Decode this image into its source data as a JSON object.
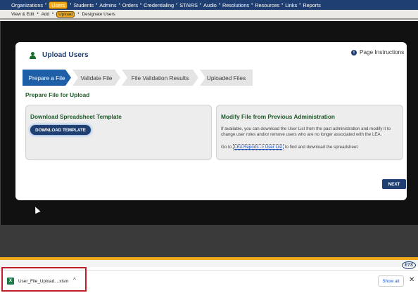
{
  "topnav": {
    "items": [
      {
        "label": "Organizations"
      },
      {
        "label": "Users",
        "active": true
      },
      {
        "label": "Students"
      },
      {
        "label": "Admins"
      },
      {
        "label": "Orders"
      },
      {
        "label": "Credentialing"
      },
      {
        "label": "STAIRS"
      },
      {
        "label": "Audio"
      },
      {
        "label": "Resolutions"
      },
      {
        "label": "Resources"
      },
      {
        "label": "Links"
      },
      {
        "label": "Reports"
      }
    ]
  },
  "subnav": {
    "items": [
      {
        "label": "View & Edit"
      },
      {
        "label": "Add"
      },
      {
        "label": "Upload",
        "active": true
      },
      {
        "label": "Designate Users"
      }
    ]
  },
  "card": {
    "title": "Upload Users",
    "instructions": "Page Instructions",
    "steps": [
      {
        "label": "Prepare a File",
        "active": true
      },
      {
        "label": "Validate File"
      },
      {
        "label": "File Validation Results"
      },
      {
        "label": "Uploaded Files"
      }
    ],
    "section_title": "Prepare File for Upload",
    "left_panel": {
      "title": "Download Spreadsheet Template",
      "button": "DOWNLOAD TEMPLATE"
    },
    "right_panel": {
      "title": "Modify File from Previous Administration",
      "text": "If available, you can download the User List from the past administration and modify it to change user roles and/or remove users who are no longer associated with the LEA.",
      "goto_prefix": "Go to",
      "goto_link": "LEA Reports -> User List",
      "goto_suffix": "to find and download the spreadsheet."
    },
    "next": "NEXT"
  },
  "footer": {
    "logo": "ETS"
  },
  "download_bar": {
    "file_name": "User_File_Upload....xlsm",
    "show_all": "Show all",
    "close": "✕",
    "chevron": "^",
    "file_icon_letter": "X"
  },
  "colors": {
    "nav": "#1f3f73",
    "accent": "#f0a81c",
    "step_active": "#1f5fa8",
    "heading_green": "#1e5a2a",
    "highlight": "#c0202a"
  }
}
